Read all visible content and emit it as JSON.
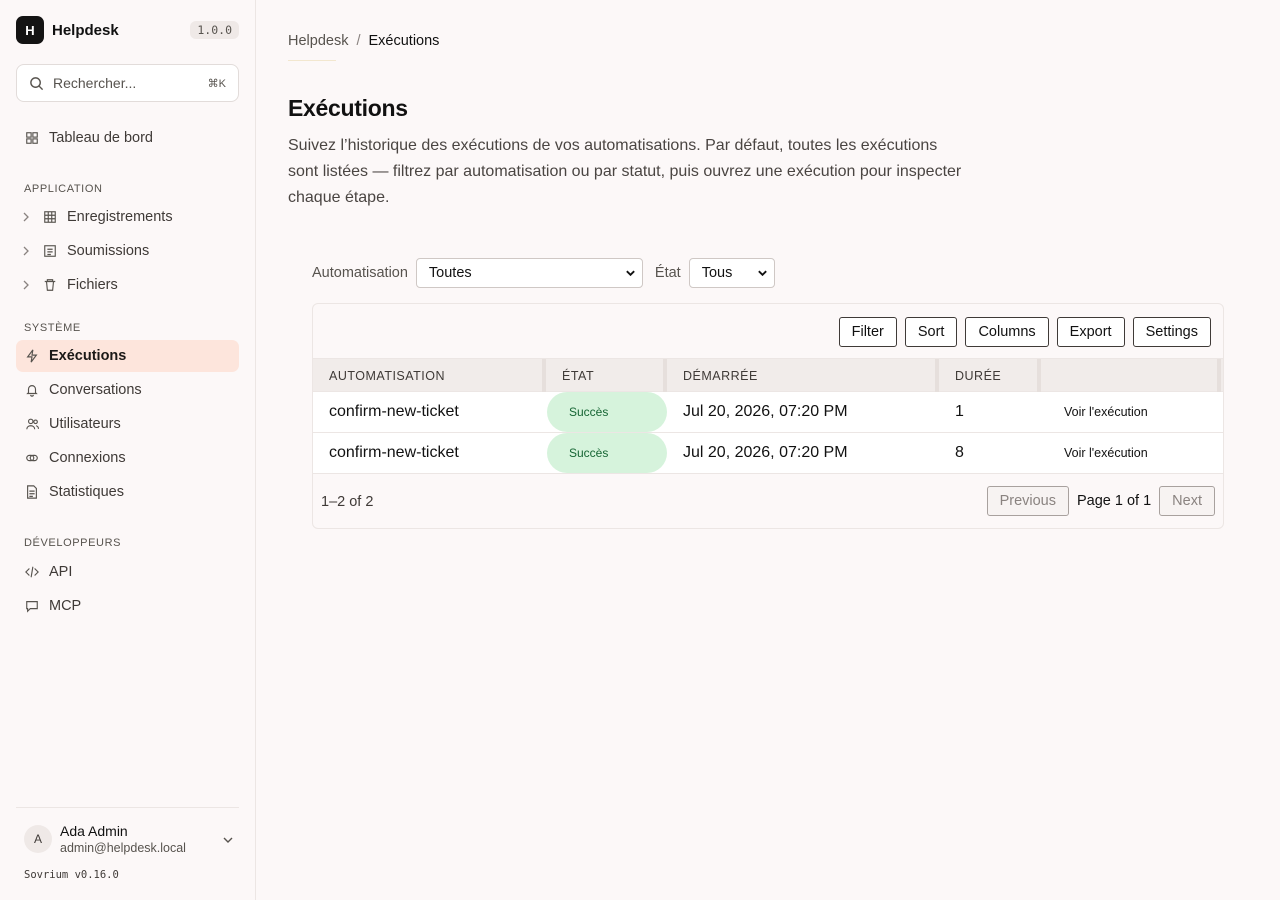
{
  "app": {
    "logo_letter": "H",
    "name": "Helpdesk",
    "version": "1.0.0"
  },
  "search": {
    "placeholder": "Rechercher...",
    "shortcut": "⌘K"
  },
  "sidebar": {
    "dashboard": "Tableau de bord",
    "application_label": "APPLICATION",
    "application_items": [
      "Enregistrements",
      "Soumissions",
      "Fichiers"
    ],
    "system_label": "SYSTÈME",
    "system_items": [
      "Exécutions",
      "Conversations",
      "Utilisateurs",
      "Connexions",
      "Statistiques"
    ],
    "developers_label": "DÉVELOPPEURS",
    "developer_items": [
      "API",
      "MCP"
    ],
    "active_item": "Exécutions"
  },
  "user": {
    "initial": "A",
    "name": "Ada Admin",
    "email": "admin@helpdesk.local"
  },
  "footer": {
    "version": "Sovrium v0.16.0"
  },
  "breadcrumb": {
    "parent": "Helpdesk",
    "separator": "/",
    "current": "Exécutions"
  },
  "page": {
    "title": "Exécutions",
    "description": "Suivez l’historique des exécutions de vos automatisations. Par défaut, toutes les exécutions sont listées — filtrez par automatisation ou par statut, puis ouvrez une exécution pour inspecter chaque étape."
  },
  "filters": {
    "automation_label": "Automatisation",
    "automation_value": "Toutes",
    "state_label": "État",
    "state_value": "Tous"
  },
  "toolbar": {
    "filter": "Filter",
    "sort": "Sort",
    "columns": "Columns",
    "export": "Export",
    "settings": "Settings"
  },
  "table": {
    "headers": [
      "AUTOMATISATION",
      "ÉTAT",
      "DÉMARRÉE",
      "DURÉE"
    ],
    "rows": [
      {
        "automation": "confirm-new-ticket",
        "state": "Succès",
        "started": "Jul 20, 2026, 07:20 PM",
        "duration": "1",
        "action": "Voir l'exécution"
      },
      {
        "automation": "confirm-new-ticket",
        "state": "Succès",
        "started": "Jul 20, 2026, 07:20 PM",
        "duration": "8",
        "action": "Voir l'exécution"
      }
    ],
    "range": "1–2 of 2",
    "previous": "Previous",
    "page_info": "Page 1 of 1",
    "next": "Next"
  },
  "colors": {
    "active_bg": "#fde5dc",
    "success_bg": "#d6f3dc",
    "success_text": "#166534"
  }
}
